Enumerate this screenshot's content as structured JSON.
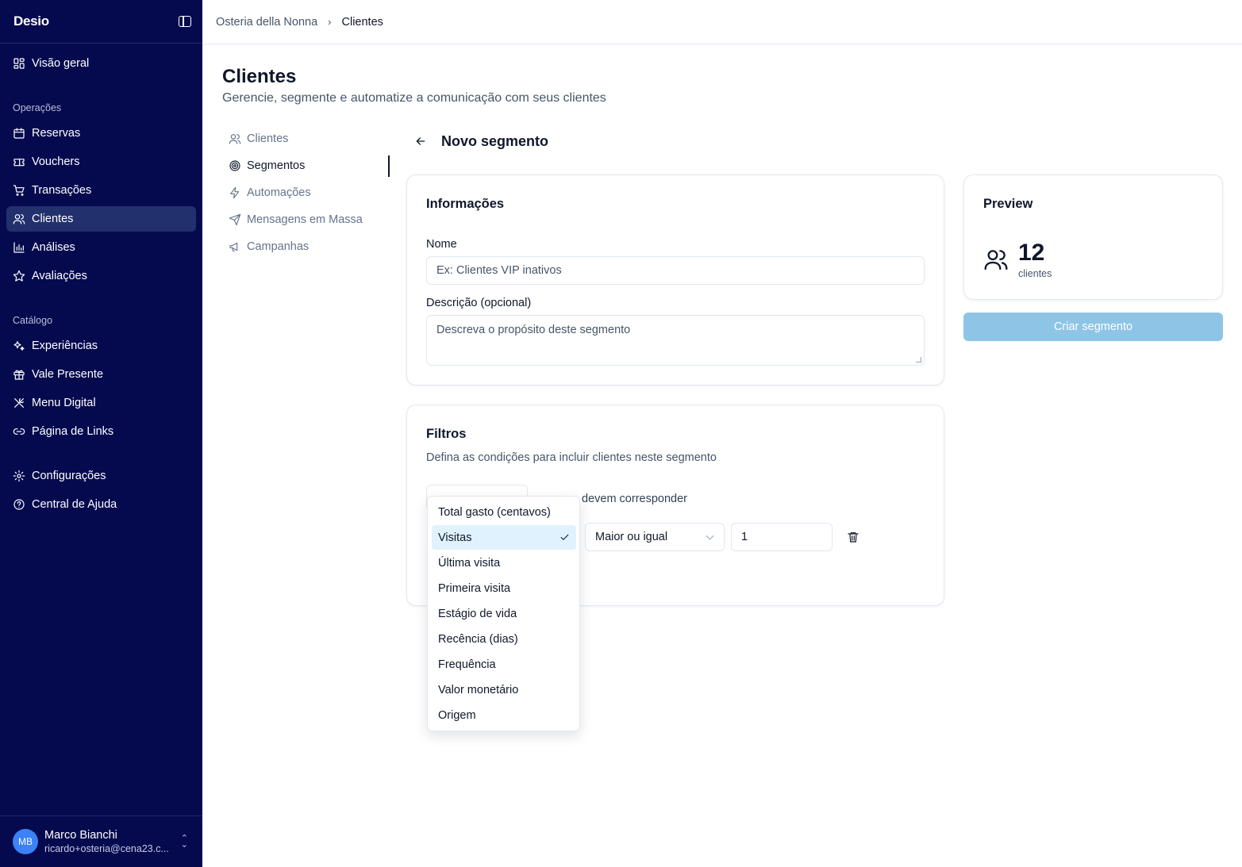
{
  "sidebar": {
    "brand": "Desio",
    "overview": "Visão geral",
    "groups": {
      "operations": "Operações",
      "catalog": "Catálogo"
    },
    "items": {
      "reservas": "Reservas",
      "vouchers": "Vouchers",
      "transacoes": "Transações",
      "clientes": "Clientes",
      "analises": "Análises",
      "avaliacoes": "Avaliações",
      "experiencias": "Experiências",
      "vale_presente": "Vale Presente",
      "menu_digital": "Menu Digital",
      "pagina_links": "Página de Links",
      "configuracoes": "Configurações",
      "central_ajuda": "Central de Ajuda"
    },
    "user": {
      "initials": "MB",
      "name": "Marco Bianchi",
      "email": "ricardo+osteria@cena23.c..."
    }
  },
  "breadcrumb": {
    "restaurant": "Osteria della Nonna",
    "separator": "›",
    "current": "Clientes"
  },
  "page": {
    "title": "Clientes",
    "subtitle": "Gerencie, segmente e automatize a comunicação com seus clientes"
  },
  "subnav": {
    "clientes": "Clientes",
    "segmentos": "Segmentos",
    "automacoes": "Automações",
    "mensagens": "Mensagens em Massa",
    "campanhas": "Campanhas"
  },
  "segment": {
    "title": "Novo segmento"
  },
  "info_card": {
    "title": "Informações",
    "name_label": "Nome",
    "name_placeholder": "Ex: Clientes VIP inativos",
    "description_label": "Descrição (opcional)",
    "description_placeholder": "Descreva o propósito deste segmento"
  },
  "filters_card": {
    "title": "Filtros",
    "subtitle": "Defina as condições para incluir clientes neste segmento",
    "match_text": "devem corresponder",
    "operator_value": "Maior ou igual",
    "amount_value": "1",
    "field_options": [
      "Total gasto (centavos)",
      "Visitas",
      "Última visita",
      "Primeira visita",
      "Estágio de vida",
      "Recência (dias)",
      "Frequência",
      "Valor monetário",
      "Origem"
    ],
    "selected_option": "Visitas"
  },
  "preview": {
    "title": "Preview",
    "count": "12",
    "unit": "clientes",
    "button": "Criar segmento"
  },
  "colors": {
    "sidebar_bg": "#050a4f",
    "sidebar_active": "#22306e",
    "primary_disabled": "#8ec5e6",
    "selected_bg": "#e0f2fe"
  }
}
